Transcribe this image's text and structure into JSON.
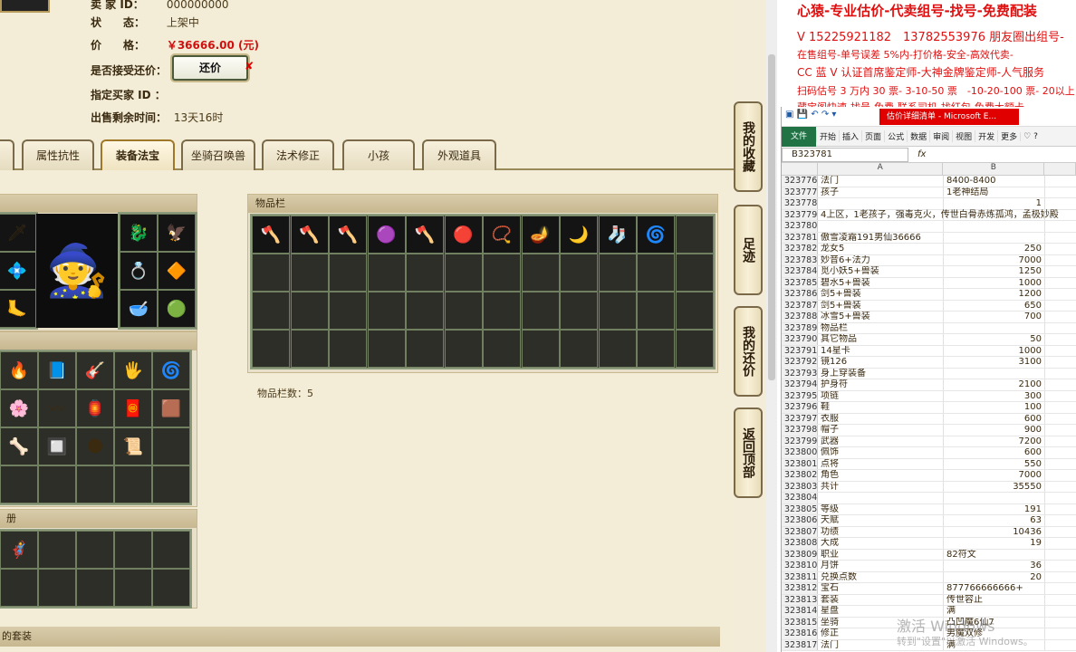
{
  "account": {
    "id_label": "卖 家 ID：",
    "id_value": "000000000",
    "status_label": "状　　态：",
    "status_value": "上架中",
    "price_label": "价　　格：",
    "price_value": "￥36666.00 (元)",
    "offer_label": "是否接受还价：",
    "offer_button": "还价",
    "offer_close": "✘",
    "buyer_label": "指定买家 ID ：",
    "buyer_value": "",
    "time_label": "出售剩余时间：",
    "time_value": "13天16时"
  },
  "tabs": [
    {
      "label": "属性抗性"
    },
    {
      "label": "装备法宝",
      "active": true
    },
    {
      "label": "坐骑召唤兽"
    },
    {
      "label": "法术修正"
    },
    {
      "label": "小孩"
    },
    {
      "label": "外观道具"
    }
  ],
  "inventory": {
    "title": "物品栏",
    "count_label": "物品栏数：5",
    "items": [
      "🪓",
      "🪓",
      "🪓",
      "🟣",
      "🪓",
      "🔴",
      "📿",
      "🪔",
      "🌙",
      "🧦",
      "🌀"
    ]
  },
  "equip_panel": {
    "items_left": [
      "🗡",
      "💠",
      "🦶"
    ],
    "items_right": [
      "🐉",
      "🦅",
      "💍",
      "🔶",
      "🥣",
      "🟢"
    ],
    "center": "🧙"
  },
  "fabao_panel": {
    "items": [
      "🔥",
      "📘",
      "🎸",
      "🖐",
      "🌀",
      "🌸",
      "〰",
      "🏮",
      "🧧",
      "🟫",
      "🦴",
      "🔲",
      "🌑",
      "📜"
    ]
  },
  "book_panel": {
    "title": "册",
    "items": [
      "🦸"
    ]
  },
  "set_panel": {
    "title": "的套装"
  },
  "side_buttons": [
    {
      "label": "我的收藏"
    },
    {
      "label": "足迹"
    },
    {
      "label": "我的还价"
    },
    {
      "label": "返回顶部"
    }
  ],
  "ad": {
    "title": "心猿-专业估价-代卖组号-找号-免费配装",
    "lines": [
      "V 15225921182　13782553976 朋友圈出组号-",
      "在售组号-单号误差 5%内-打价格-安全-高效代卖-",
      "CC 蓝 V 认证首席鉴定师-大神金牌鉴定师-人气服务",
      "扫码估号 3 万内 30 票- 3-10-50 票　-10-20-100 票- 20以上 150",
      "藏宝阁快速-找号-免费-联系司机-找红包-免费大额卡"
    ]
  },
  "excel": {
    "window_title": "估价详细清单 - Microsoft E...",
    "ribbon_file": "文件",
    "ribbon_tabs": [
      "开始",
      "插入",
      "页面",
      "公式",
      "数据",
      "审阅",
      "视图",
      "开发",
      "更多"
    ],
    "name_box": "B323781",
    "fx": "fx",
    "col_a": "A",
    "col_b": "B",
    "rows": [
      {
        "n": "323776",
        "a": "法门",
        "b": "8400-8400",
        "num": false
      },
      {
        "n": "323777",
        "a": "孩子",
        "b": "1老神结局",
        "num": false
      },
      {
        "n": "323778",
        "a": "",
        "b": "1",
        "num": true
      },
      {
        "n": "323779",
        "a": "4上区，1老孩子，强毒克火，传世白骨赤炼孤鸿，孟极妙殿",
        "b": "",
        "num": false,
        "wide": true
      },
      {
        "n": "323780",
        "a": "",
        "b": "",
        "num": false
      },
      {
        "n": "323781",
        "a": "傲雪凌霜191男仙36666",
        "b": "",
        "num": false
      },
      {
        "n": "323782",
        "a": "龙女5",
        "b": "250",
        "num": true
      },
      {
        "n": "323783",
        "a": "妙音6+法力",
        "b": "7000",
        "num": true
      },
      {
        "n": "323784",
        "a": "觅小妖5+兽装",
        "b": "1250",
        "num": true
      },
      {
        "n": "323785",
        "a": "碧水5+兽装",
        "b": "1000",
        "num": true
      },
      {
        "n": "323786",
        "a": "剑5+兽装",
        "b": "1200",
        "num": true
      },
      {
        "n": "323787",
        "a": "剑5+兽装",
        "b": "650",
        "num": true
      },
      {
        "n": "323788",
        "a": "冰雪5+兽装",
        "b": "700",
        "num": true
      },
      {
        "n": "323789",
        "a": "物品栏",
        "b": "",
        "num": false
      },
      {
        "n": "323790",
        "a": "其它物品",
        "b": "50",
        "num": true
      },
      {
        "n": "323791",
        "a": "14星卡",
        "b": "1000",
        "num": true
      },
      {
        "n": "323792",
        "a": "镜126",
        "b": "3100",
        "num": true
      },
      {
        "n": "323793",
        "a": "身上穿装备",
        "b": "",
        "num": false
      },
      {
        "n": "323794",
        "a": "护身符",
        "b": "2100",
        "num": true
      },
      {
        "n": "323795",
        "a": "项链",
        "b": "300",
        "num": true
      },
      {
        "n": "323796",
        "a": "鞋",
        "b": "100",
        "num": true
      },
      {
        "n": "323797",
        "a": "衣服",
        "b": "600",
        "num": true
      },
      {
        "n": "323798",
        "a": "帽子",
        "b": "900",
        "num": true
      },
      {
        "n": "323799",
        "a": "武器",
        "b": "7200",
        "num": true
      },
      {
        "n": "323800",
        "a": "佩饰",
        "b": "600",
        "num": true
      },
      {
        "n": "323801",
        "a": "点将",
        "b": "550",
        "num": true
      },
      {
        "n": "323802",
        "a": "角色",
        "b": "7000",
        "num": true
      },
      {
        "n": "323803",
        "a": "共计",
        "b": "35550",
        "num": true
      },
      {
        "n": "323804",
        "a": "",
        "b": "",
        "num": false
      },
      {
        "n": "323805",
        "a": "等级",
        "b": "191",
        "num": true
      },
      {
        "n": "323806",
        "a": "天赋",
        "b": "63",
        "num": true
      },
      {
        "n": "323807",
        "a": "功绩",
        "b": "10436",
        "num": true
      },
      {
        "n": "323808",
        "a": "大成",
        "b": "19",
        "num": true
      },
      {
        "n": "323809",
        "a": "职业",
        "b": "82符文",
        "num": false
      },
      {
        "n": "323810",
        "a": "月饼",
        "b": "36",
        "num": true
      },
      {
        "n": "323811",
        "a": "兑换点数",
        "b": "20",
        "num": true
      },
      {
        "n": "323812",
        "a": "宝石",
        "b": "877766666666+",
        "num": false
      },
      {
        "n": "323813",
        "a": "套装",
        "b": "传世容止",
        "num": false
      },
      {
        "n": "323814",
        "a": "星盘",
        "b": "满",
        "num": false
      },
      {
        "n": "323815",
        "a": "坐骑",
        "b": "凸凹魔6仙7",
        "num": false
      },
      {
        "n": "323816",
        "a": "修正",
        "b": "男魔双修",
        "num": false
      },
      {
        "n": "323817",
        "a": "法门",
        "b": "满",
        "num": false
      }
    ]
  },
  "watermark": {
    "line1": "激活 Windows",
    "line2": "转到\"设置\"以激活 Windows。"
  }
}
